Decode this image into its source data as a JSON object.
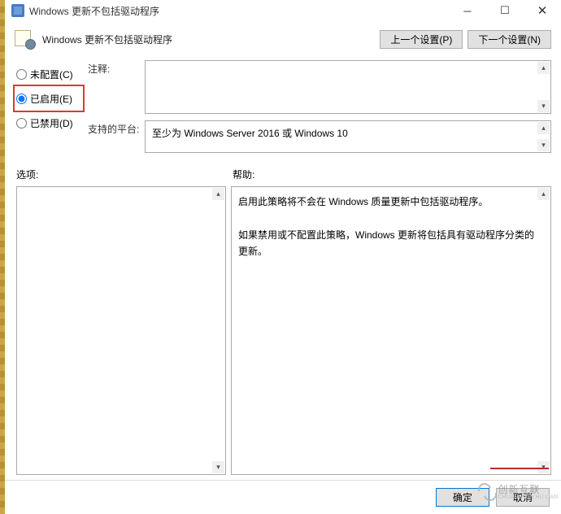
{
  "titlebar": {
    "title": "Windows 更新不包括驱动程序"
  },
  "header": {
    "title": "Windows 更新不包括驱动程序",
    "prev_btn": "上一个设置(P)",
    "next_btn": "下一个设置(N)"
  },
  "radios": {
    "not_configured": "未配置(C)",
    "enabled": "已启用(E)",
    "disabled": "已禁用(D)"
  },
  "fields": {
    "comment_label": "注释:",
    "platform_label": "支持的平台:",
    "platform_value": "至少为 Windows Server 2016 或 Windows 10"
  },
  "lower": {
    "options_label": "选项:",
    "help_label": "帮助:",
    "help_text_1": "启用此策略将不会在 Windows 质量更新中包括驱动程序。",
    "help_text_2": "如果禁用或不配置此策略，Windows 更新将包括具有驱动程序分类的更新。"
  },
  "buttons": {
    "ok": "确定",
    "cancel": "取消"
  },
  "watermark": {
    "zh": "创新互联",
    "en": "CHUANG XIN HU LIAN"
  }
}
